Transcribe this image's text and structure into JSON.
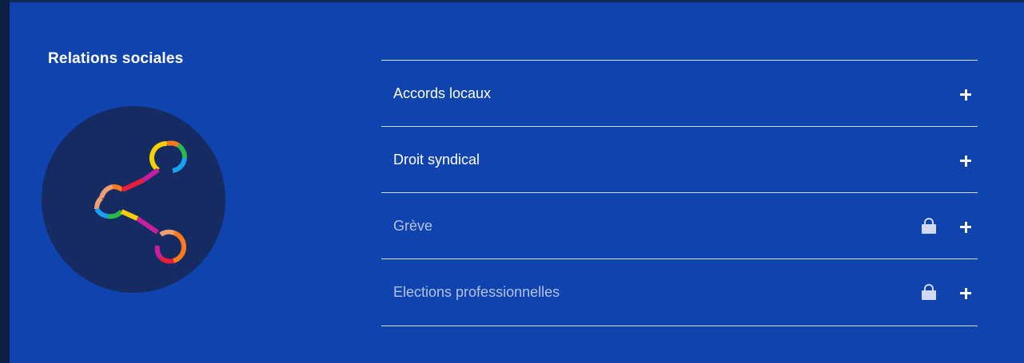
{
  "section": {
    "title": "Relations sociales",
    "icon": "share-icon"
  },
  "accordion": {
    "items": [
      {
        "label": "Accords locaux",
        "locked": false
      },
      {
        "label": "Droit syndical",
        "locked": false
      },
      {
        "label": "Grève",
        "locked": true
      },
      {
        "label": "Elections professionnelles",
        "locked": true
      }
    ]
  },
  "colors": {
    "background": "#0f44ae",
    "circle": "#162b62",
    "text": "#ffffff",
    "locked_text": "#b3c1e6"
  }
}
